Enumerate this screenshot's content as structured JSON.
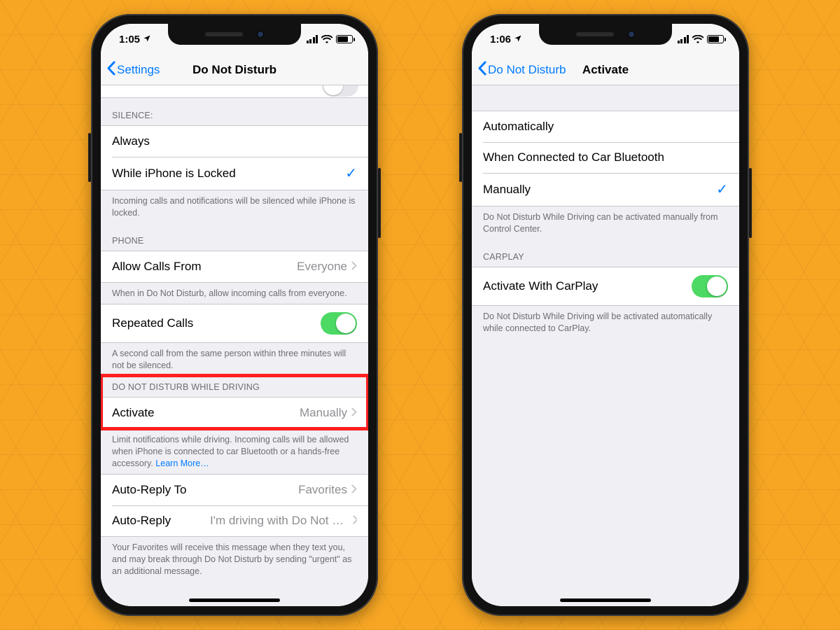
{
  "left": {
    "status": {
      "time": "1:05"
    },
    "nav": {
      "back": "Settings",
      "title": "Do Not Disturb"
    },
    "silence": {
      "header": "SILENCE:",
      "always": "Always",
      "locked": "While iPhone is Locked",
      "footer": "Incoming calls and notifications will be silenced while iPhone is locked."
    },
    "phone": {
      "header": "PHONE",
      "allow_label": "Allow Calls From",
      "allow_value": "Everyone",
      "allow_footer": "When in Do Not Disturb, allow incoming calls from everyone.",
      "repeated_label": "Repeated Calls",
      "repeated_footer": "A second call from the same person within three minutes will not be silenced."
    },
    "driving": {
      "header": "DO NOT DISTURB WHILE DRIVING",
      "activate_label": "Activate",
      "activate_value": "Manually",
      "footer_a": "Limit notifications while driving. Incoming calls will be allowed when iPhone is connected to car Bluetooth or a hands-free accessory. ",
      "learn_more": "Learn More…"
    },
    "autoreply": {
      "to_label": "Auto-Reply To",
      "to_value": "Favorites",
      "reply_label": "Auto-Reply",
      "reply_value": "I'm driving with Do Not Disturb…",
      "footer": "Your Favorites will receive this message when they text you, and may break through Do Not Disturb by sending \"urgent\" as an additional message."
    }
  },
  "right": {
    "status": {
      "time": "1:06"
    },
    "nav": {
      "back": "Do Not Disturb",
      "title": "Activate"
    },
    "options": {
      "auto": "Automatically",
      "bt": "When Connected to Car Bluetooth",
      "manual": "Manually",
      "footer": "Do Not Disturb While Driving can be activated manually from Control Center."
    },
    "carplay": {
      "header": "CARPLAY",
      "label": "Activate With CarPlay",
      "footer": "Do Not Disturb While Driving will be activated automatically while connected to CarPlay."
    }
  }
}
